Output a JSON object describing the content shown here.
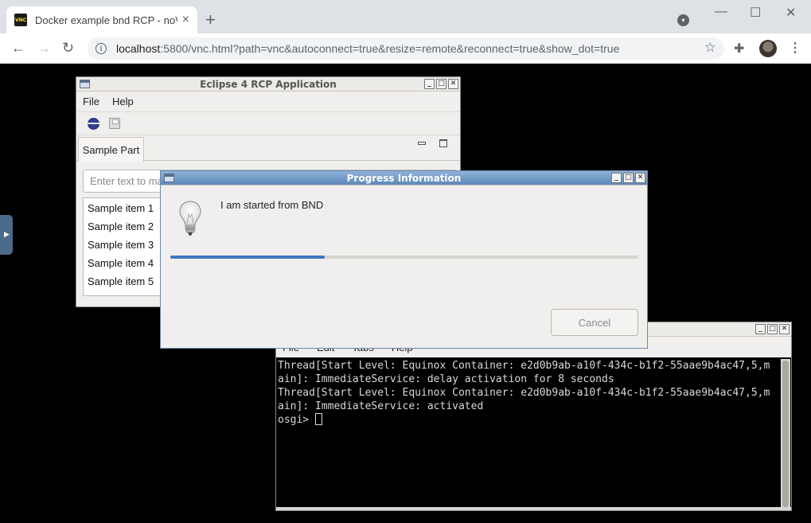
{
  "browser": {
    "tab_title": "Docker example bnd RCP - noVNC",
    "tab_favicon": "VNC",
    "url_host": "localhost",
    "url_rest": ":5800/vnc.html?path=vnc&autoconnect=true&resize=remote&reconnect=true&show_dot=true",
    "new_tab_glyph": "+",
    "close_glyph": "×"
  },
  "eclipse": {
    "title": "Eclipse 4 RCP Application",
    "menu": [
      "File",
      "Help"
    ],
    "part_tab": "Sample Part",
    "input_placeholder": "Enter text to mark part as dirty",
    "items": [
      "Sample item 1",
      "Sample item 2",
      "Sample item 3",
      "Sample item 4",
      "Sample item 5"
    ]
  },
  "terminal": {
    "menu": [
      "File",
      "Edit",
      "Tabs",
      "Help"
    ],
    "lines": [
      "Thread[Start Level: Equinox Container: e2d0b9ab-a10f-434c-b1f2-55aae9b4ac47,5,m",
      "ain]: ImmediateService: delay activation for 8 seconds",
      "Thread[Start Level: Equinox Container: e2d0b9ab-a10f-434c-b1f2-55aae9b4ac47,5,m",
      "ain]: ImmediateService: activated"
    ],
    "prompt": "osgi> "
  },
  "dialog": {
    "title": "Progress Information",
    "message": "I am started from BND",
    "progress": 0.33,
    "cancel_label": "Cancel"
  },
  "icons": {
    "back": "back-arrow-icon",
    "forward": "forward-arrow-icon",
    "reload": "reload-icon",
    "info": "site-info-icon",
    "bookmark": "star-icon",
    "extensions": "puzzle-icon",
    "menu": "kebab-menu-icon",
    "lightbulb": "lightbulb-icon"
  },
  "colors": {
    "dialog_title_active": "#5e88b8",
    "progress_fill": "#3d76c4",
    "desktop": "#000000"
  }
}
